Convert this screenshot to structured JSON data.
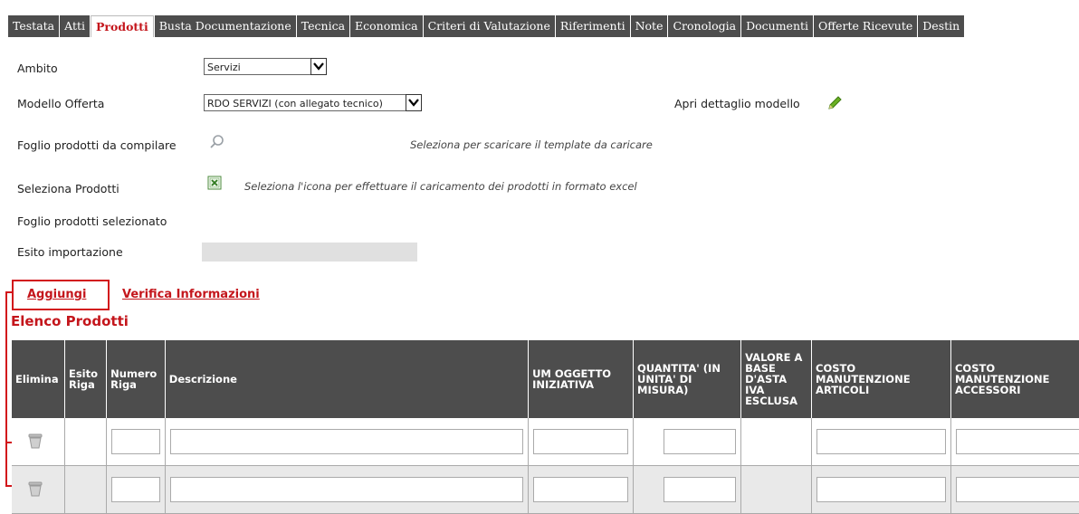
{
  "tabs": [
    "Testata",
    "Atti",
    "Prodotti",
    "Busta Documentazione",
    "Tecnica",
    "Economica",
    "Criteri di Valutazione",
    "Riferimenti",
    "Note",
    "Cronologia",
    "Documenti",
    "Offerte Ricevute",
    "Destin"
  ],
  "active_tab": "Prodotti",
  "form": {
    "ambito_label": "Ambito",
    "ambito_value": "Servizi",
    "modello_label": "Modello Offerta",
    "modello_value": "RDO SERVIZI (con allegato tecnico)",
    "apri_dettaglio": "Apri dettaglio modello",
    "foglio_label": "Foglio prodotti da compilare",
    "foglio_hint": "Seleziona per scaricare il template da caricare",
    "seleziona_label": "Seleziona Prodotti",
    "seleziona_hint": "Seleziona l'icona per effettuare il caricamento dei prodotti in formato excel",
    "foglio_selezionato_label": "Foglio prodotti selezionato",
    "esito_label": "Esito importazione"
  },
  "actions": {
    "aggiungi": "Aggiungi",
    "verifica": "Verifica Informazioni"
  },
  "section_title": "Elenco Prodotti",
  "table": {
    "headers": [
      "Elimina",
      "Esito Riga",
      "Numero Riga",
      "Descrizione",
      "UM OGGETTO INIZIATIVA",
      "QUANTITA' (IN UNITA' DI MISURA)",
      "VALORE A BASE D'ASTA IVA ESCLUSA",
      "COSTO MANUTENZIONE ARTICOLI",
      "COSTO MANUTENZIONE ACCESSORI"
    ],
    "rows": 2
  },
  "colors": {
    "tab_bg": "#4d4d4d",
    "accent_red": "#c4161c",
    "header_bg": "#4d4d4d"
  }
}
